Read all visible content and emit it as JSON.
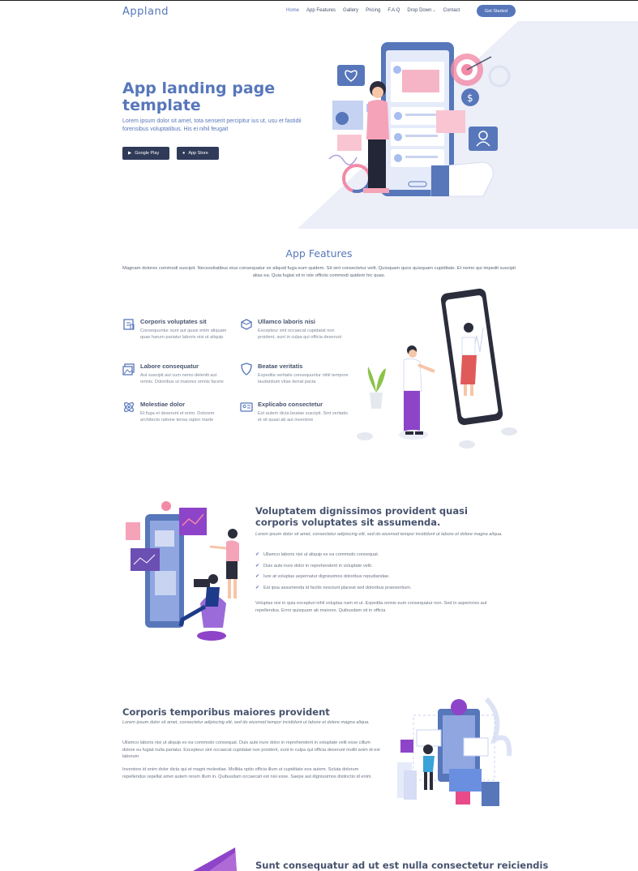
{
  "brand": {
    "logo": "Appland"
  },
  "nav": {
    "items": [
      {
        "label": "Home",
        "active": true
      },
      {
        "label": "App Features"
      },
      {
        "label": "Gallery"
      },
      {
        "label": "Pricing"
      },
      {
        "label": "F.A.Q"
      },
      {
        "label": "Drop Down"
      },
      {
        "label": "Contact"
      }
    ],
    "cta": "Get Started"
  },
  "hero": {
    "title": "App landing page template",
    "subtitle": "Lorem ipsum dolor sit amet, tota senserit percipitur ius ut, usu et fastidii forensibus voluptatibus. His ei nihil feugait",
    "google_play": "Google Play",
    "app_store": "App Store"
  },
  "features": {
    "title": "App Features",
    "description": "Magnam dolores commodi suscipit. Necessitatibus eius consequatur ex aliquid fuga eum quidem. Sit sint consectetur velit. Quisquam quos quisquam cupiditate. Et nemo qui impedit suscipit alias ea. Quia fugiat sit in iste officiis commodi quidem hic quas.",
    "items": [
      {
        "title": "Corporis voluptates sit",
        "desc": "Consequuntur sunt aut quasi enim aliquam quae harum pariatur laboris nisi ut aliquip",
        "icon": "receipt-icon"
      },
      {
        "title": "Ullamco laboris nisi",
        "desc": "Excepteur sint occaecat cupidatat non proident, sunt in culpa qui officia deserunt",
        "icon": "cube-icon"
      },
      {
        "title": "Labore consequatur",
        "desc": "Aut suscipit aut cum nemo deleniti aut omnis. Doloribus ut maiores omnis facere",
        "icon": "images-icon"
      },
      {
        "title": "Beatae veritatis",
        "desc": "Expedita veritatis consequuntur nihil tempore laudantium vitae denat pacta",
        "icon": "shield-icon"
      },
      {
        "title": "Molestiae dolor",
        "desc": "Et fuga et deserunt et enim. Dolorem architecto ratione tensa raptor marte",
        "icon": "atom-icon"
      },
      {
        "title": "Explicabo consectetur",
        "desc": "Est autem dicta beatae suscipit. Sint veritatis et sit quasi ab aut inventore",
        "icon": "id-card-icon"
      }
    ]
  },
  "details": [
    {
      "title": "Voluptatem dignissimos provident quasi corporis voluptates sit assumenda.",
      "italic": "Lorem ipsum dolor sit amet, consectetur adipiscing elit, sed do eiusmod tempor incididunt ut labore et dolore magna aliqua.",
      "list": [
        "Ullamco laboris nisi ut aliquip ex ea commodo consequat.",
        "Duis aute irure dolor in reprehenderit in voluptate velit.",
        "Iure at voluptas aspernatur dignissimos doloribus repudiandae.",
        "Est ipsa assumenda id facilis nesciunt placeat sed doloribus praesentium."
      ],
      "text": "Voluptas nisi in quia excepturi nihil voluptas nam et ut. Expedita omnis eum consequatur non. Sed in asperiores aut repellendus. Error quisquam ab maiores. Quibusdam sit in officia"
    },
    {
      "title": "Corporis temporibus maiores provident",
      "italic": "Lorem ipsum dolor sit amet, consectetur adipiscing elit, sed do eiusmod tempor incididunt ut labore et dolore magna aliqua.",
      "text1": "Ullamco laboris nisi ut aliquip ex ea commodo consequat. Duis aute irure dolor in reprehenderit in voluptate velit esse cillum dolore eu fugiat nulla pariatur. Excepteur sint occaecat cupidatat non proident, sunt in culpa qui officia deserunt mollit anim id est laborum",
      "text2": "Inventore id enim dolor dicta qui et magni molestiae. Mollitia optio officia illum ut cupiditate eos autem. Soluta dolorum repellendus repellat amet autem rerum illum in. Quibusdam occaecati est nisi esse. Saepe aut dignissimos distinctio id enim."
    },
    {
      "title": "Sunt consequatur ad ut est nulla consectetur reiciendis"
    }
  ],
  "colors": {
    "accent": "#5777ba",
    "dark": "#2f3b59",
    "hero_bg": "#eceef8",
    "pink": "#f5a3b8"
  }
}
